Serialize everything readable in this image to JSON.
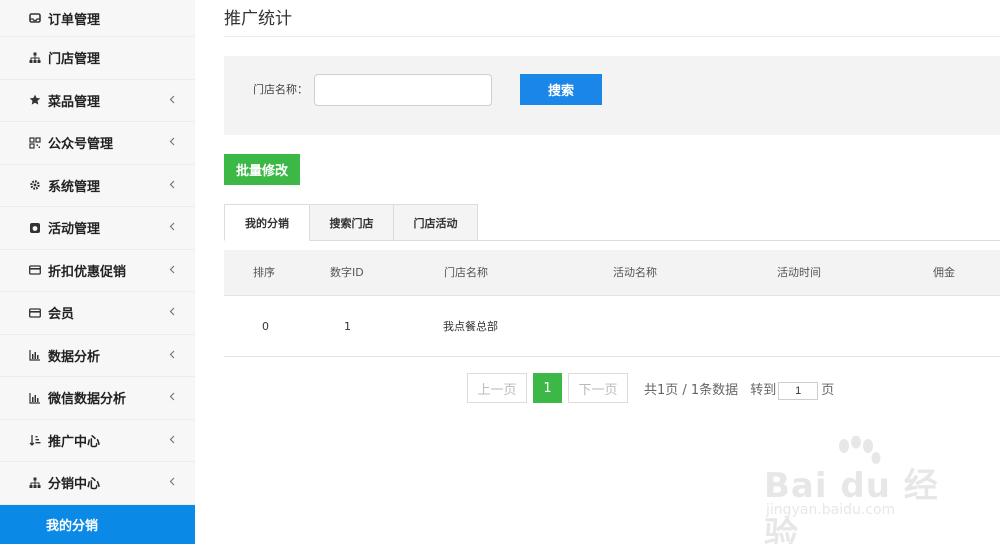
{
  "sidebar": {
    "items": [
      {
        "label": "订单管理",
        "icon": "inbox-icon",
        "has_chevron": false
      },
      {
        "label": "门店管理",
        "icon": "sitemap-icon",
        "has_chevron": false
      },
      {
        "label": "菜品管理",
        "icon": "star-icon",
        "has_chevron": true
      },
      {
        "label": "公众号管理",
        "icon": "qrcode-icon",
        "has_chevron": true
      },
      {
        "label": "系统管理",
        "icon": "gear-icon",
        "has_chevron": true
      },
      {
        "label": "活动管理",
        "icon": "github-icon",
        "has_chevron": true
      },
      {
        "label": "折扣优惠促销",
        "icon": "credit-card-icon",
        "has_chevron": true
      },
      {
        "label": "会员",
        "icon": "credit-card-icon",
        "has_chevron": true
      },
      {
        "label": "数据分析",
        "icon": "bar-chart-icon",
        "has_chevron": true
      },
      {
        "label": "微信数据分析",
        "icon": "bar-chart-icon",
        "has_chevron": true
      },
      {
        "label": "推广中心",
        "icon": "sort-icon",
        "has_chevron": true
      },
      {
        "label": "分销中心",
        "icon": "sitemap-icon",
        "has_chevron": true
      }
    ],
    "active_sub": "我的分销",
    "accent_color": "#0a89e6"
  },
  "header": {
    "title": "推广统计"
  },
  "search": {
    "label": "门店名称：",
    "value": "",
    "placeholder": "",
    "button_label": "搜索"
  },
  "toolbar": {
    "batch_label": "批量修改"
  },
  "tabs": [
    {
      "label": "我的分销",
      "active": true
    },
    {
      "label": "搜索门店",
      "active": false
    },
    {
      "label": "门店活动",
      "active": false
    }
  ],
  "table": {
    "columns": [
      "排序",
      "数字ID",
      "门店名称",
      "活动名称",
      "活动时间",
      "佣金"
    ],
    "rows": [
      [
        "0",
        "1",
        "我点餐总部",
        "",
        "",
        ""
      ]
    ]
  },
  "pagination": {
    "prev_label": "上一页",
    "current_page": "1",
    "next_label": "下一页",
    "info": "共1页 / 1条数据",
    "goto_label": "转到",
    "goto_value": "1",
    "unit_label": "页",
    "active_color": "#3cb846"
  },
  "watermark": {
    "brand": "Bai du 经验",
    "url": "jingyan.baidu.com"
  }
}
